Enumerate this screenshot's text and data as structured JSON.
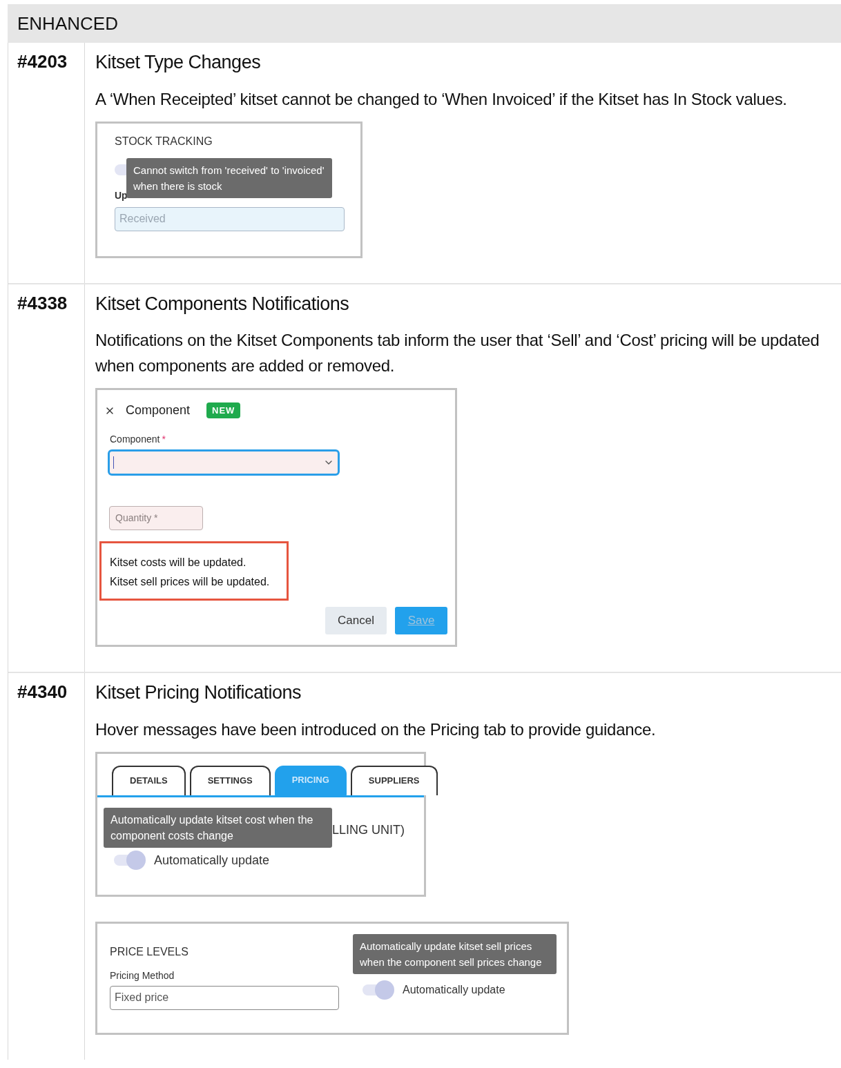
{
  "section": {
    "title": "ENHANCED"
  },
  "items": [
    {
      "id": "#4203",
      "title": "Kitset Type Changes",
      "description": "A ‘When Receipted’ kitset cannot be changed to ‘When Invoiced’ if the Kitset has In Stock values.",
      "screenshots": [
        {
          "kind": "stock_tracking",
          "heading": "STOCK TRACKING",
          "toggle_on": true,
          "tooltip": "Cannot switch from 'received' to 'invoiced' when there is stock",
          "label_fragment": "Up",
          "value": "Received"
        }
      ]
    },
    {
      "id": "#4338",
      "title": "Kitset Components Notifications",
      "description": "Notifications on the Kitset Components tab inform the user that ‘Sell’ and ‘Cost’ pricing will be updated when components are added or removed.",
      "screenshots": [
        {
          "kind": "component_dialog",
          "title": "Component",
          "badge": "NEW",
          "field_label": "Component",
          "required_mark": "*",
          "quantity_placeholder": "Quantity *",
          "notices": [
            "Kitset costs will be updated.",
            "Kitset sell prices will be updated."
          ],
          "buttons": [
            {
              "label": "Cancel",
              "kind": "secondary"
            },
            {
              "label": "Save",
              "kind": "primary"
            }
          ]
        }
      ]
    },
    {
      "id": "#4340",
      "title": "Kitset Pricing Notifications",
      "description": "Hover messages have been introduced on the Pricing tab to provide guidance.",
      "screenshots": [
        {
          "kind": "pricing_tabs",
          "tabs": [
            {
              "label": "DETAILS",
              "selected": false
            },
            {
              "label": "SETTINGS",
              "selected": false
            },
            {
              "label": "PRICING",
              "selected": true
            },
            {
              "label": "SUPPLIERS",
              "selected": false
            }
          ],
          "tooltip": "Automatically update kitset cost when the component costs change",
          "heading_fragment": "LLING UNIT)",
          "toggle_on": true,
          "toggle_label": "Automatically update"
        },
        {
          "kind": "price_levels",
          "heading": "PRICE LEVELS",
          "field_label": "Pricing Method",
          "value": "Fixed price",
          "tooltip": "Automatically update kitset sell prices when the component sell prices change",
          "toggle_on": true,
          "toggle_label": "Automatically update"
        }
      ]
    }
  ]
}
